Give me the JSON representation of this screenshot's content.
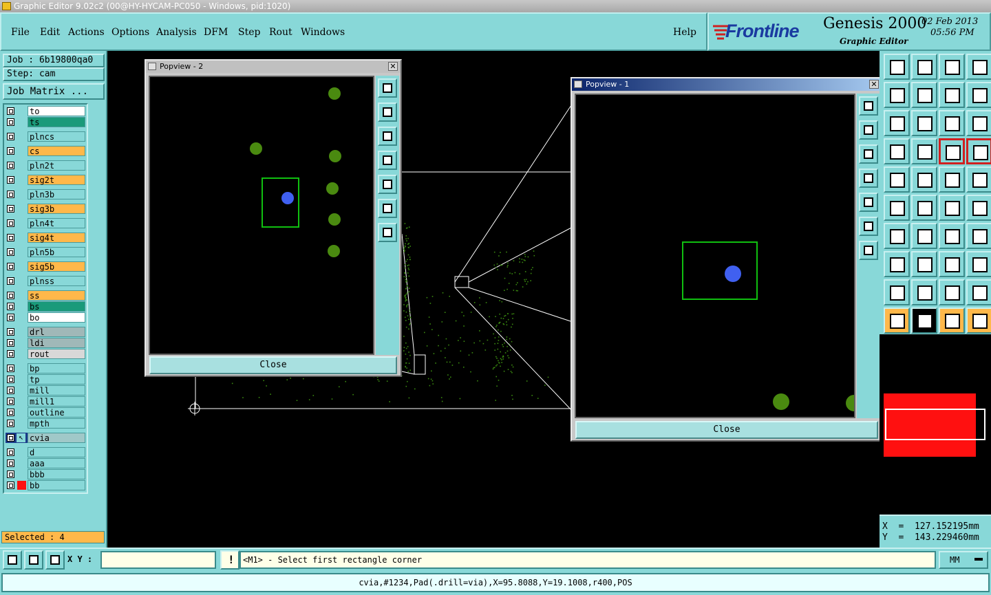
{
  "window_title": "Graphic Editor 9.02c2 (00@HY-HYCAM-PC050 - Windows, pid:1020)",
  "menu": [
    "File",
    "Edit",
    "Actions",
    "Options",
    "Analysis",
    "DFM",
    "Step",
    "Rout",
    "Windows"
  ],
  "help_label": "Help",
  "brand": {
    "logo": "Frontline",
    "product": "Genesis 2000",
    "subtitle": "Graphic Editor",
    "date": "02 Feb 2013",
    "time": "05:56 PM"
  },
  "job": {
    "job_label": "Job : 6b19800qa0",
    "step_label": "Step: cam",
    "matrix_button": "Job Matrix ..."
  },
  "layers": [
    {
      "name": "to",
      "color": "#ffffff"
    },
    {
      "name": "ts",
      "color": "#1a9a7a"
    },
    {
      "name": "plncs",
      "color": "#88d8d8"
    },
    {
      "name": "cs",
      "color": "#ffb84a"
    },
    {
      "name": "pln2t",
      "color": "#88d8d8"
    },
    {
      "name": "sig2t",
      "color": "#ffb84a"
    },
    {
      "name": "pln3b",
      "color": "#88d8d8"
    },
    {
      "name": "sig3b",
      "color": "#ffb84a"
    },
    {
      "name": "pln4t",
      "color": "#88d8d8"
    },
    {
      "name": "sig4t",
      "color": "#ffb84a"
    },
    {
      "name": "pln5b",
      "color": "#88d8d8"
    },
    {
      "name": "sig5b",
      "color": "#ffb84a"
    },
    {
      "name": "plnss",
      "color": "#88d8d8"
    },
    {
      "name": "ss",
      "color": "#ffb84a"
    },
    {
      "name": "bs",
      "color": "#1a9a7a"
    },
    {
      "name": "bo",
      "color": "#ffffff"
    },
    {
      "name": "drl",
      "color": "#a0b8b8"
    },
    {
      "name": "ldi",
      "color": "#a0b8b8"
    },
    {
      "name": "rout",
      "color": "#d8d8d8"
    },
    {
      "name": "bp",
      "color": "#88d8d8"
    },
    {
      "name": "tp",
      "color": "#88d8d8"
    },
    {
      "name": "mill",
      "color": "#88d8d8"
    },
    {
      "name": "mill1",
      "color": "#88d8d8"
    },
    {
      "name": "outline",
      "color": "#88d8d8"
    },
    {
      "name": "mpth",
      "color": "#88d8d8"
    },
    {
      "name": "cvia",
      "color": "#a0c8c8"
    },
    {
      "name": "d",
      "color": "#88d8d8"
    },
    {
      "name": "aaa",
      "color": "#88d8d8"
    },
    {
      "name": "bbb",
      "color": "#88d8d8"
    },
    {
      "name": "bb",
      "color": "#88d8d8"
    }
  ],
  "selected_label": "Selected : 4",
  "popview2": {
    "title": "Popview - 2",
    "close_label": "Close"
  },
  "popview1": {
    "title": "Popview - 1",
    "close_label": "Close"
  },
  "coords": {
    "x": "X  =  127.152195mm",
    "y": "Y  =  143.229460mm"
  },
  "xy_label": "X Y :",
  "xy_value": "",
  "prompt": "<M1> - Select first rectangle corner",
  "units": "MM",
  "feature_info": "cvia,#1234,Pad(.drill=via),X=95.8088,Y=19.1008,r400,POS",
  "colors": {
    "teal": "#88d8d8",
    "orange": "#ffb84a",
    "green": "#1a9a7a",
    "pad_green": "#4a8a10",
    "pad_blue": "#4060f0",
    "select_green": "#10c010"
  }
}
